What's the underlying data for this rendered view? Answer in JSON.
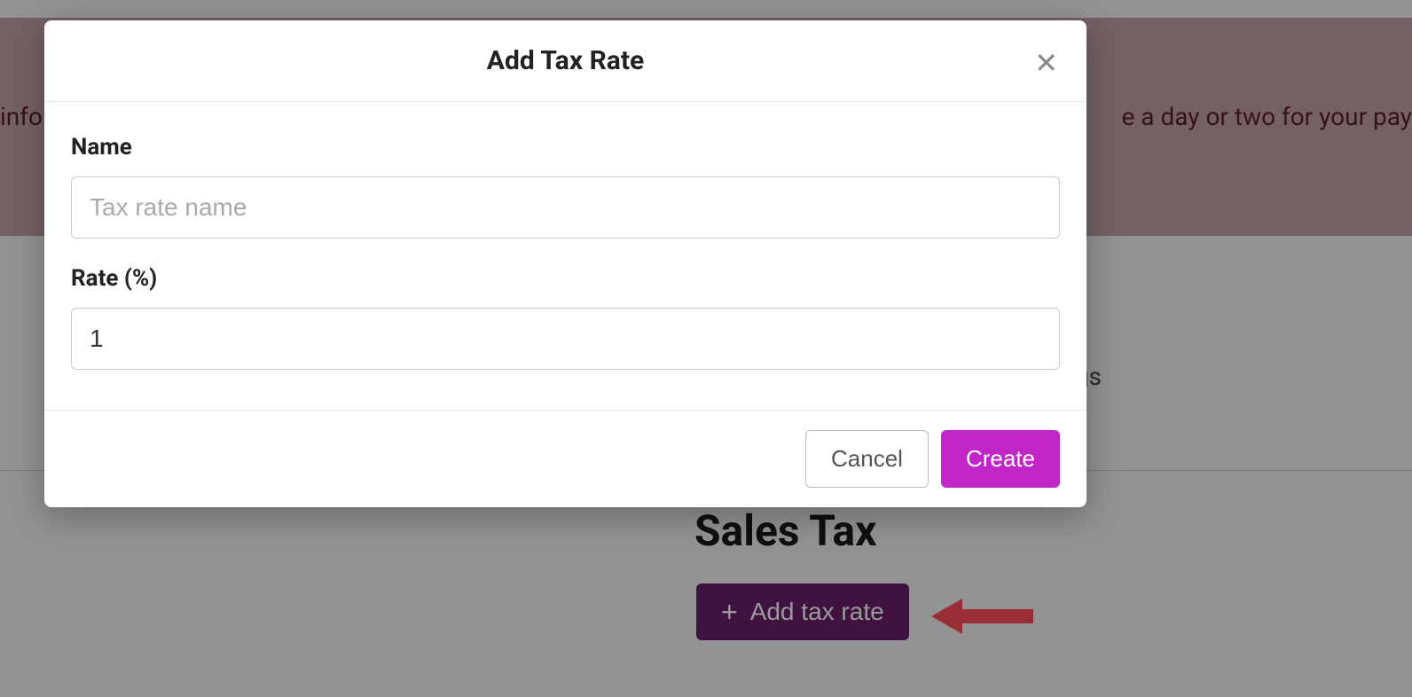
{
  "banner": {
    "text_left": "info",
    "text_right": "e a day or two for your pay"
  },
  "background": {
    "settings_text": "ngs",
    "sales_tax_heading": "Sales Tax",
    "add_tax_rate_btn_label": "Add tax rate"
  },
  "modal": {
    "title": "Add Tax Rate",
    "name_label": "Name",
    "name_placeholder": "Tax rate name",
    "name_value": "",
    "rate_label": "Rate (%)",
    "rate_value": "1",
    "cancel_label": "Cancel",
    "create_label": "Create"
  }
}
